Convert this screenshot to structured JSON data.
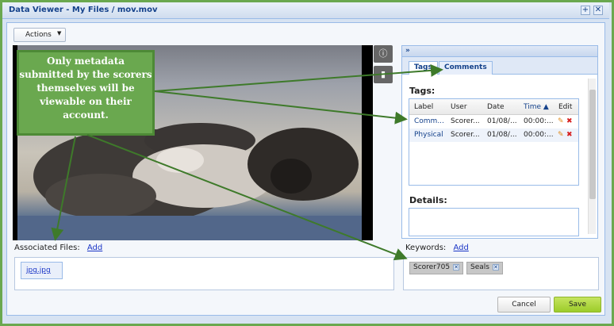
{
  "window": {
    "title": "Data Viewer - My Files / mov.mov"
  },
  "toolbar": {
    "actions_label": "Actions"
  },
  "video_controls": {
    "info_icon": "info-icon",
    "doc_icon": "document-icon"
  },
  "right_panel": {
    "collapse_label": "»",
    "tabs": [
      {
        "label": "Tags"
      },
      {
        "label": "Comments"
      }
    ],
    "tags_heading": "Tags:",
    "grid": {
      "headers": [
        "Label",
        "User",
        "Date",
        "Time ▲",
        "Edit"
      ],
      "rows": [
        {
          "label": "Comm...",
          "user": "Scorer...",
          "date": "01/08/...",
          "time": "00:00:..."
        },
        {
          "label": "Physical",
          "user": "Scorer...",
          "date": "01/08/...",
          "time": "00:00:..."
        }
      ]
    },
    "details_heading": "Details:"
  },
  "associated_files": {
    "label": "Associated Files:",
    "add": "Add",
    "files": [
      "jpg.jpg"
    ]
  },
  "keywords": {
    "label": "Keywords:",
    "add": "Add",
    "items": [
      "Scorer705",
      "Seals"
    ]
  },
  "footer": {
    "cancel": "Cancel",
    "save": "Save"
  },
  "callout": {
    "text": "Only metadata submitted by the scorers themselves will be viewable on their account."
  },
  "colors": {
    "accent": "#6aa84f",
    "link": "#1a35c6",
    "save": "#9ccc2a"
  }
}
